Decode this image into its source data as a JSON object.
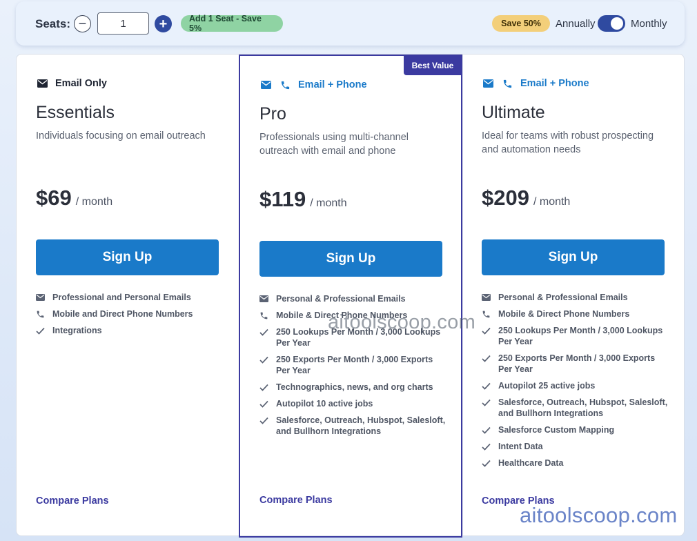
{
  "seats": {
    "label": "Seats:",
    "minus_symbol": "−",
    "value": "1",
    "plus_symbol": "+",
    "promo": "Add 1 Seat - Save 5%"
  },
  "billing": {
    "save_badge": "Save 50%",
    "annually_label": "Annually",
    "monthly_label": "Monthly",
    "selected": "Monthly"
  },
  "colors": {
    "primary_button": "#1a7ac9",
    "accent_purple": "#3b3aa0",
    "promo_green": "#8fd3a3",
    "save_yellow": "#f3cf7a"
  },
  "plans": [
    {
      "channel_icons": [
        "envelope-icon"
      ],
      "channel_label": "Email Only",
      "name": "Essentials",
      "description": "Individuals focusing on email outreach",
      "price": "$69",
      "per": "/ month",
      "cta": "Sign Up",
      "features": [
        {
          "icon": "envelope-icon",
          "text": "Professional and Personal Emails"
        },
        {
          "icon": "phone-icon",
          "text": "Mobile and Direct Phone Numbers"
        },
        {
          "icon": "check-icon",
          "text": "Integrations"
        }
      ],
      "compare": "Compare Plans"
    },
    {
      "badge": "Best Value",
      "channel_icons": [
        "envelope-icon",
        "phone-icon"
      ],
      "channel_label": "Email + Phone",
      "name": "Pro",
      "description": "Professionals using multi-channel outreach with email and phone",
      "price": "$119",
      "per": "/ month",
      "cta": "Sign Up",
      "features": [
        {
          "icon": "envelope-icon",
          "text": "Personal & Professional Emails"
        },
        {
          "icon": "phone-icon",
          "text": "Mobile & Direct Phone Numbers"
        },
        {
          "icon": "check-icon",
          "text": "250 Lookups Per Month / 3,000 Lookups Per Year"
        },
        {
          "icon": "check-icon",
          "text": "250 Exports Per Month / 3,000 Exports Per Year"
        },
        {
          "icon": "check-icon",
          "text": "Technographics, news, and org charts"
        },
        {
          "icon": "check-icon",
          "text": "Autopilot 10 active jobs"
        },
        {
          "icon": "check-icon",
          "text": "Salesforce, Outreach, Hubspot, Salesloft, and Bullhorn Integrations"
        }
      ],
      "compare": "Compare Plans"
    },
    {
      "channel_icons": [
        "envelope-icon",
        "phone-icon"
      ],
      "channel_label": "Email + Phone",
      "name": "Ultimate",
      "description": "Ideal for teams with robust prospecting and automation needs",
      "price": "$209",
      "per": "/ month",
      "cta": "Sign Up",
      "features": [
        {
          "icon": "envelope-icon",
          "text": "Personal & Professional Emails"
        },
        {
          "icon": "phone-icon",
          "text": "Mobile & Direct Phone Numbers"
        },
        {
          "icon": "check-icon",
          "text": "250 Lookups Per Month / 3,000 Lookups Per Year"
        },
        {
          "icon": "check-icon",
          "text": "250 Exports Per Month / 3,000 Exports Per Year"
        },
        {
          "icon": "check-icon",
          "text": "Autopilot 25 active jobs"
        },
        {
          "icon": "check-icon",
          "text": "Salesforce, Outreach, Hubspot, Salesloft, and Bullhorn Integrations"
        },
        {
          "icon": "check-icon",
          "text": "Salesforce Custom Mapping"
        },
        {
          "icon": "check-icon",
          "text": "Intent Data"
        },
        {
          "icon": "check-icon",
          "text": "Healthcare Data"
        }
      ],
      "compare": "Compare Plans"
    }
  ],
  "watermarks": [
    "aitoolscoop.com",
    "aitoolscoop.com"
  ]
}
